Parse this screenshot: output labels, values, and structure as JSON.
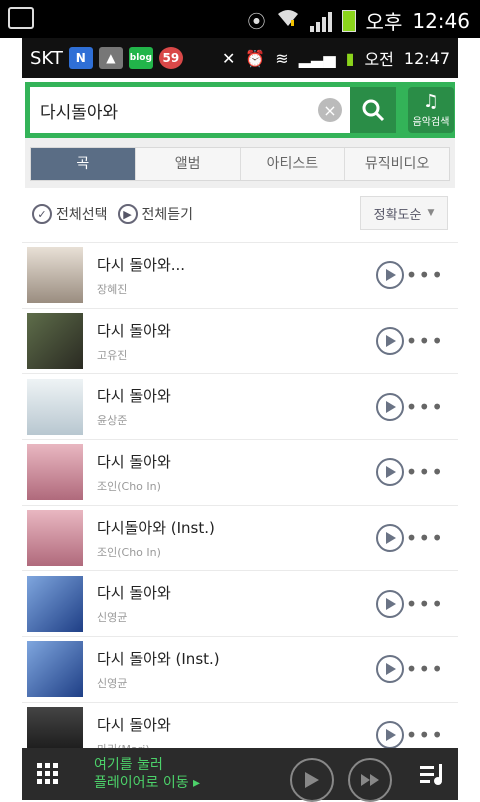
{
  "status_bar": {
    "time": "12:46",
    "ampm": "오후"
  },
  "inner_status": {
    "carrier": "SKT",
    "time": "12:47",
    "ampm": "오전",
    "badge_blog": "blog",
    "badge_count": "59"
  },
  "search": {
    "value": "다시돌아와",
    "placeholder": ""
  },
  "music_search_label": "음악검색",
  "tabs": [
    "곡",
    "앨범",
    "아티스트",
    "뮤직비디오"
  ],
  "actions": {
    "select_all": "전체선택",
    "play_all": "전체듣기",
    "sort": "정확도순"
  },
  "songs": [
    {
      "title": "다시 돌아와...",
      "artist": "장혜진",
      "thumb_color": "#c9b9aa"
    },
    {
      "title": "다시 돌아와",
      "artist": "고유진",
      "thumb_color": "#4a5a3e"
    },
    {
      "title": "다시 돌아와",
      "artist": "윤상준",
      "thumb_color": "#d5e0e6"
    },
    {
      "title": "다시 돌아와",
      "artist": "조인(Cho In)",
      "thumb_color": "#c98a98"
    },
    {
      "title": "다시돌아와 (Inst.)",
      "artist": "조인(Cho In)",
      "thumb_color": "#c98a98"
    },
    {
      "title": "다시 돌아와",
      "artist": "신영균",
      "thumb_color": "#3a5ea6"
    },
    {
      "title": "다시 돌아와 (Inst.)",
      "artist": "신영균",
      "thumb_color": "#3a5ea6"
    },
    {
      "title": "다시 돌아와",
      "artist": "마리(Mari)",
      "thumb_color": "#2a2a2a"
    }
  ],
  "player": {
    "line1": "여기를 눌러",
    "line2": "플레이어로 이동 ▸"
  }
}
